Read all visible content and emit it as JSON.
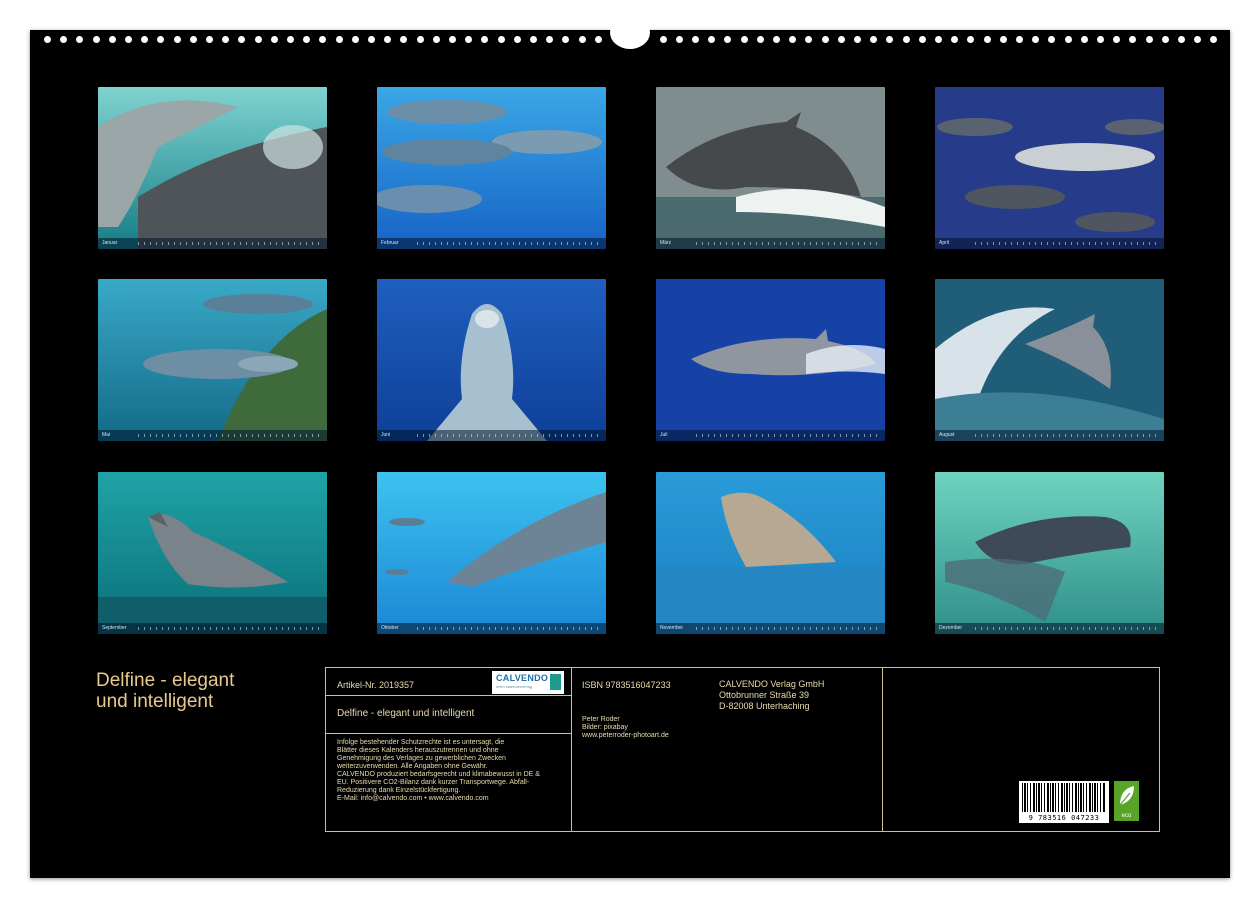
{
  "calendar": {
    "title_line1": "Delfine - elegant",
    "title_line2": "und intelligent",
    "months": [
      {
        "label": "Januar"
      },
      {
        "label": "Februar"
      },
      {
        "label": "März"
      },
      {
        "label": "April"
      },
      {
        "label": "Mai"
      },
      {
        "label": "Juni"
      },
      {
        "label": "Juli"
      },
      {
        "label": "August"
      },
      {
        "label": "September"
      },
      {
        "label": "Oktober"
      },
      {
        "label": "November"
      },
      {
        "label": "Dezember"
      }
    ]
  },
  "info": {
    "article_no": "Artikel-Nr. 2019357",
    "logo": {
      "text": "CALVENDO",
      "sub": "mein kalenderverlag"
    },
    "product_title": "Delfine - elegant und intelligent",
    "legal_lines": [
      "Infolge bestehender Schutzrechte ist es untersagt, die",
      "Blätter dieses Kalenders herauszutrennen und ohne",
      "Genehmigung des Verlages zu gewerblichen Zwecken",
      "weiterzuverwenden. Alle Angaben ohne Gewähr.",
      "CALVENDO produziert bedarfsgerecht und klimabewusst in DE &",
      "EU. Positivere CO2-Bilanz dank kurzer Transportwege. Abfall-",
      "Reduzierung dank Einzelstückfertigung.",
      "E-Mail: info@calvendo.com • www.calvendo.com"
    ],
    "isbn": "ISBN 9783516047233",
    "author_lines": [
      "Peter Roder",
      "Bilder: pixabay",
      "www.peterroder-photoart.de"
    ],
    "publisher_lines": [
      "CALVENDO Verlag GmbH",
      "Ottobrunner Straße 39",
      "D-82008 Unterhaching"
    ],
    "barcode_number": "9 783516 047233",
    "eco_label": "eco"
  }
}
